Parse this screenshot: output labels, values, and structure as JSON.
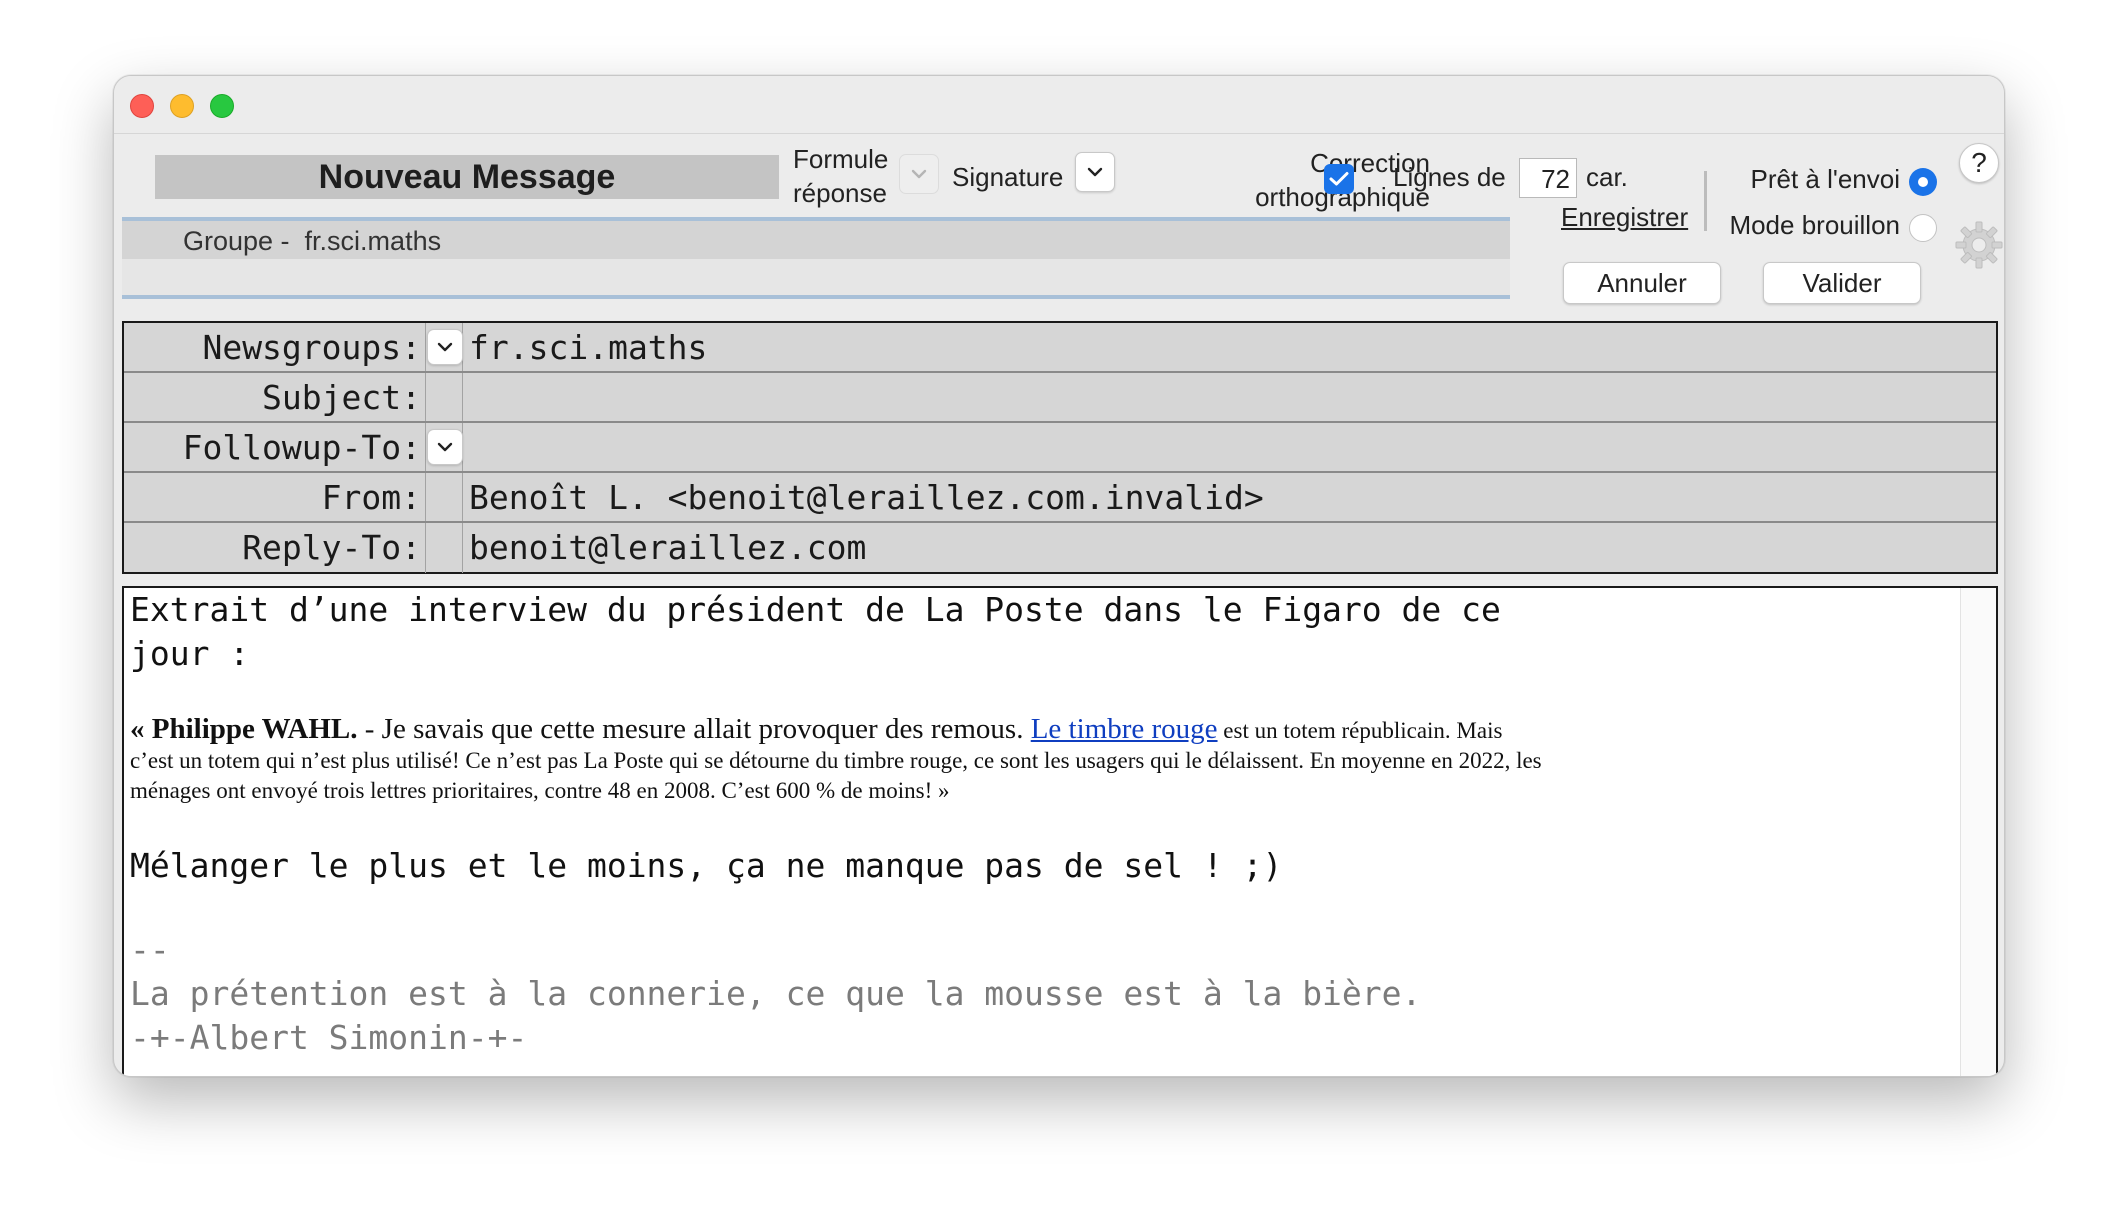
{
  "window": {
    "title": "Nouveau Message"
  },
  "toolbar": {
    "formule_line1": "Formule",
    "formule_line2": "réponse",
    "signature_label": "Signature",
    "correction_line1": "Correction",
    "correction_line2": "orthographique",
    "correction_checked": true,
    "lignes_label": "Lignes de",
    "lignes_value": "72",
    "lignes_unit": "car.",
    "save_label": "Enregistrer",
    "ready_label": "Prêt à l'envoi",
    "draft_label": "Mode brouillon",
    "help_label": "?",
    "cancel_label": "Annuler",
    "validate_label": "Valider"
  },
  "group": {
    "label": "Groupe -  fr.sci.maths"
  },
  "headers": [
    {
      "name": "Newsgroups:",
      "value": "fr.sci.maths",
      "has_popup": true
    },
    {
      "name": "Subject:",
      "value": "",
      "has_popup": false
    },
    {
      "name": "Followup-To:",
      "value": "",
      "has_popup": true
    },
    {
      "name": "From:",
      "value": "Benoît L. <benoit@leraillez.com.invalid>",
      "has_popup": false
    },
    {
      "name": "Reply-To:",
      "value": "benoit@leraillez.com",
      "has_popup": false
    }
  ],
  "body": {
    "intro_line1": "Extrait d’une interview du président de La Poste dans le Figaro de ce",
    "intro_line2": "jour :",
    "quote_open": "« ",
    "quote_speaker": "Philippe WAHL.",
    "quote_part1": " - Je savais que cette mesure allait provoquer des remous. ",
    "quote_link": "Le timbre rouge",
    "quote_part2": " est un totem républicain. Mais c’est un totem qui n’est plus utilisé! Ce n’est pas La Poste qui se détourne du timbre rouge, ce sont les usagers qui le délaissent. En moyenne en 2022, les ménages ont envoyé trois lettres prioritaires, contre 48 en 2008. C’est 600 % de moins! »",
    "comment": "Mélanger le plus et le moins, ça ne manque pas de sel ! ;)",
    "sig_sep": "--",
    "sig_line1": "La prétention est à la connerie, ce que la mousse est à la bière.",
    "sig_line2": "-+-Albert Simonin-+-"
  },
  "colors": {
    "accent": "#1a73e8",
    "link": "#0f3ec0",
    "signature_text": "#7b7b7b"
  }
}
